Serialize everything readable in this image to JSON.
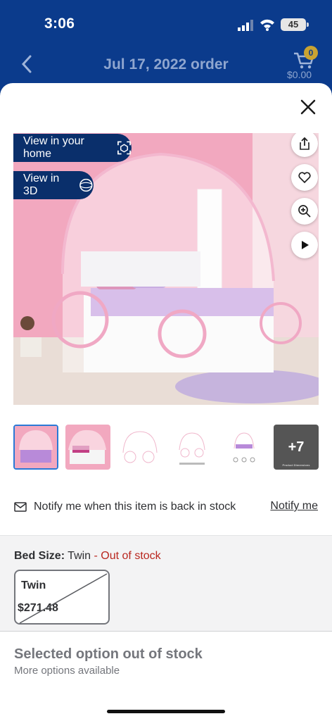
{
  "status_bar": {
    "time": "3:06",
    "battery": "45"
  },
  "nav": {
    "title": "Jul 17, 2022 order",
    "cart_count": "0",
    "cart_total": "$0.00"
  },
  "hero": {
    "view_in_home": "View in your home",
    "view_in_3d": "View in 3D",
    "side_icons": [
      "share-icon",
      "heart-icon",
      "zoom-icon",
      "play-icon"
    ]
  },
  "thumbnails": {
    "more_count": "+7",
    "more_caption": "Product Dimensions"
  },
  "notify": {
    "text": "Notify me when this item is back in stock",
    "link": "Notify me"
  },
  "variant": {
    "label": "Bed Size:",
    "value": "Twin",
    "separator": " - ",
    "status": "Out of stock",
    "options": [
      {
        "name": "Twin",
        "price": "$271.48"
      }
    ]
  },
  "footer": {
    "title": "Selected option out of stock",
    "subtitle": "More options available"
  },
  "colors": {
    "header_bg": "#0b3b8c",
    "pill_bg": "#0a2f6b",
    "oos_red": "#b9271f",
    "badge": "#c9a332"
  }
}
